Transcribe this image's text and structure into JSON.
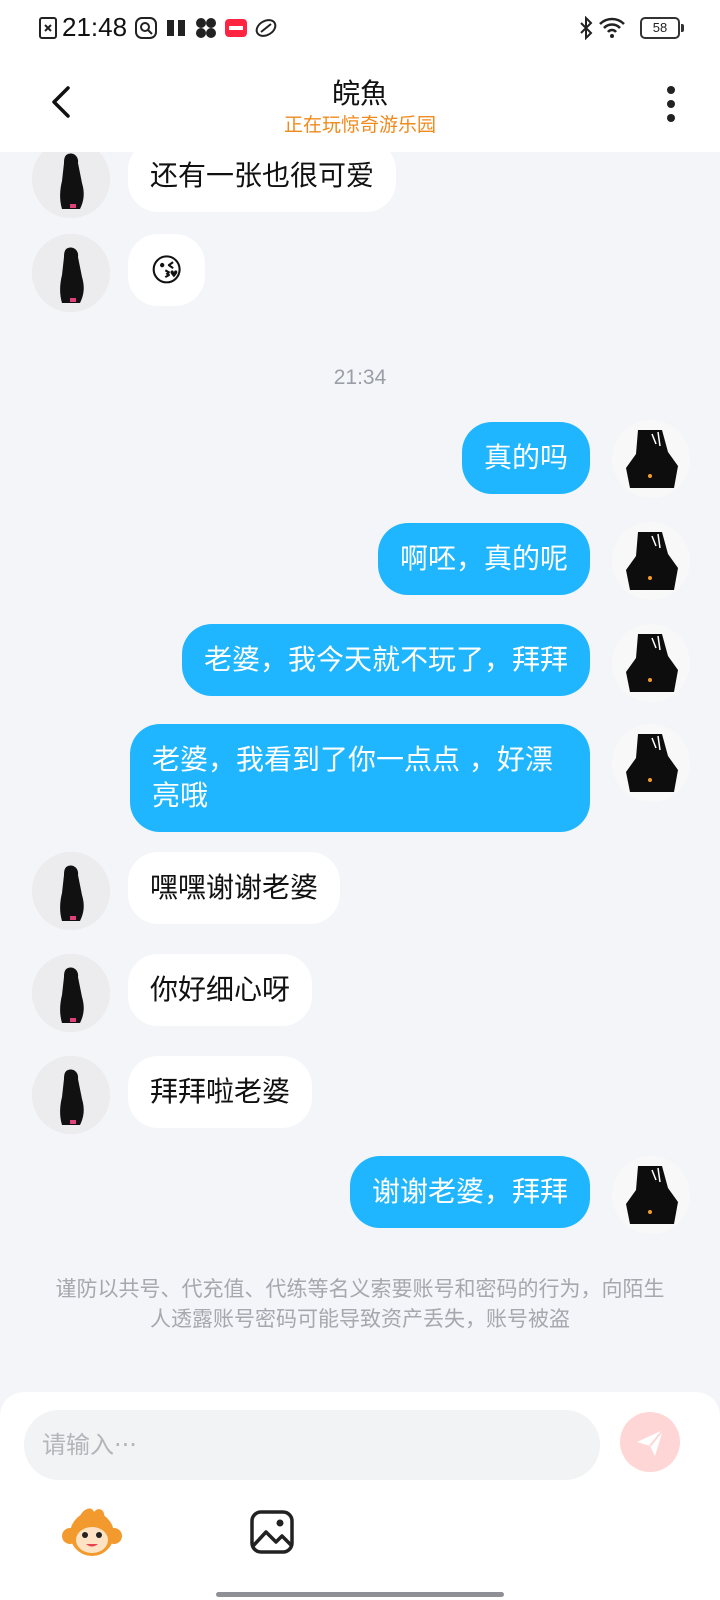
{
  "status_bar": {
    "time": "21:48",
    "battery": "58",
    "app_icons": [
      "notification-x-icon",
      "search-app-icon",
      "book-icon",
      "pinwheel-icon",
      "xiaohongshu-icon",
      "game-app-icon"
    ],
    "right_icons": [
      "bluetooth-icon",
      "wifi-icon",
      "battery-icon"
    ]
  },
  "header": {
    "title": "皖魚",
    "subtitle": "正在玩惊奇游乐园",
    "subtitle_color": "#f08a1c",
    "back_icon": "chevron-left-icon",
    "more_icon": "more-vertical-icon"
  },
  "colors": {
    "outgoing_bubble": "#1fb6ff",
    "incoming_bubble": "#ffffff",
    "background": "#f3f5f8"
  },
  "messages": [
    {
      "side": "in",
      "text": "还有一张也很可爱"
    },
    {
      "side": "in",
      "text": "😘"
    },
    {
      "timestamp": "21:34"
    },
    {
      "side": "out",
      "text": "真的吗"
    },
    {
      "side": "out",
      "text": "啊呸，真的呢"
    },
    {
      "side": "out",
      "text": "老婆，我今天就不玩了，拜拜"
    },
    {
      "side": "out",
      "text": "老婆，我看到了你一点点 ，好漂亮哦"
    },
    {
      "side": "in",
      "text": "嘿嘿谢谢老婆"
    },
    {
      "side": "in",
      "text": "你好细心呀"
    },
    {
      "side": "in",
      "text": "拜拜啦老婆"
    },
    {
      "side": "out",
      "text": "谢谢老婆，拜拜"
    }
  ],
  "notice": "谨防以共号、代充值、代练等名义索要账号和密码的行为，向陌生人透露账号密码可能导致资产丢失，账号被盗",
  "input": {
    "placeholder": "请输入···",
    "send_icon": "send-paper-plane-icon",
    "emoji_icon": "monkey-emoji-icon",
    "image_icon": "image-icon"
  }
}
